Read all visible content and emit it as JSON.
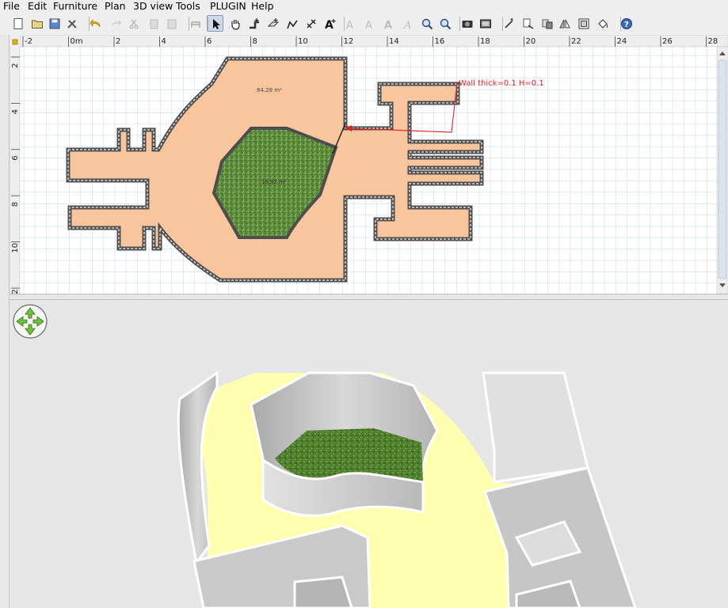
{
  "menu": {
    "items": [
      {
        "id": "file",
        "label": "File"
      },
      {
        "id": "edit",
        "label": "Edit"
      },
      {
        "id": "furniture",
        "label": "Furniture"
      },
      {
        "id": "plan",
        "label": "Plan"
      },
      {
        "id": "view3d",
        "label": "3D view"
      },
      {
        "id": "tools",
        "label": "Tools"
      },
      {
        "id": "plugin",
        "label": "PLUGIN"
      },
      {
        "id": "help",
        "label": "Help"
      }
    ]
  },
  "toolbar": {
    "buttons": [
      {
        "name": "new-home",
        "icon": "new-document-icon"
      },
      {
        "name": "open",
        "icon": "open-folder-icon"
      },
      {
        "name": "save",
        "icon": "save-disk-icon"
      },
      {
        "name": "preferences",
        "icon": "preferences-tools-icon"
      },
      {
        "name": "undo",
        "icon": "undo-arrow-icon"
      },
      {
        "name": "redo",
        "icon": "redo-arrow-icon"
      },
      {
        "name": "cut",
        "icon": "scissors-icon"
      },
      {
        "name": "copy",
        "icon": "copy-icon"
      },
      {
        "name": "paste",
        "icon": "paste-clipboard-icon"
      },
      {
        "name": "add-furniture",
        "icon": "add-furniture-icon"
      },
      {
        "name": "select-mode",
        "icon": "arrow-cursor-icon",
        "selected": true
      },
      {
        "name": "pan-mode",
        "icon": "hand-icon"
      },
      {
        "name": "create-walls",
        "icon": "create-walls-icon"
      },
      {
        "name": "create-rooms",
        "icon": "create-rooms-icon"
      },
      {
        "name": "create-polylines",
        "icon": "create-polylines-icon"
      },
      {
        "name": "create-dimensions",
        "icon": "create-dimensions-icon"
      },
      {
        "name": "add-text",
        "icon": "add-text-icon"
      },
      {
        "name": "text-style-1",
        "icon": "text-style-icon"
      },
      {
        "name": "text-style-2",
        "icon": "text-style-icon"
      },
      {
        "name": "text-bold",
        "icon": "text-bold-icon"
      },
      {
        "name": "text-italic",
        "icon": "text-italic-icon"
      },
      {
        "name": "zoom-in",
        "icon": "zoom-in-icon"
      },
      {
        "name": "zoom-out",
        "icon": "zoom-out-icon"
      },
      {
        "name": "create-photo",
        "icon": "camera-icon"
      },
      {
        "name": "create-video",
        "icon": "video-icon"
      },
      {
        "name": "plugin-1",
        "icon": "plugin-wand-icon"
      },
      {
        "name": "plugin-2",
        "icon": "plugin-export-icon"
      },
      {
        "name": "plugin-3",
        "icon": "plugin-copy-icon"
      },
      {
        "name": "plugin-4",
        "icon": "plugin-mirror-icon"
      },
      {
        "name": "plugin-5",
        "icon": "plugin-frame-icon"
      },
      {
        "name": "plugin-6",
        "icon": "plugin-paint-icon"
      },
      {
        "name": "help",
        "icon": "help-question-icon"
      }
    ]
  },
  "plan": {
    "ruler_x": [
      "-2",
      "0m",
      "2",
      "4",
      "6",
      "8",
      "10",
      "12",
      "14",
      "16",
      "18",
      "20",
      "22",
      "24",
      "26",
      "28"
    ],
    "ruler_y": [
      "2",
      "4",
      "6",
      "8",
      "10",
      "12"
    ],
    "room_large_area": "84.28 m²",
    "room_small_area": "18.82 m²",
    "wall_tooltip": "Wall thick=0.1 H=0.1",
    "colors": {
      "floor": "#f9c59c",
      "garden": "#5c8a3c",
      "wall": "#555555",
      "grid": "#c8d6e4",
      "tooltip": "#e02020"
    }
  },
  "view3d": {
    "navigation_icon": "navigation-arrows-icon",
    "colors": {
      "background": "#e6e6e6",
      "floor": "#ffffb0",
      "wall_top": "#ffffff",
      "wall_side": "#c4c4c4",
      "grass": "#4f7f2d"
    }
  }
}
